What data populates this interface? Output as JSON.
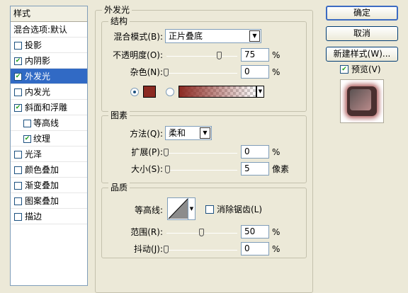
{
  "styles_panel": {
    "header": "样式",
    "blend_options": "混合选项:默认",
    "items": [
      {
        "label": "投影",
        "checked": false,
        "selected": false,
        "indent": 0
      },
      {
        "label": "内阴影",
        "checked": true,
        "selected": false,
        "indent": 0
      },
      {
        "label": "外发光",
        "checked": true,
        "selected": true,
        "indent": 0
      },
      {
        "label": "内发光",
        "checked": false,
        "selected": false,
        "indent": 0
      },
      {
        "label": "斜面和浮雕",
        "checked": true,
        "selected": false,
        "indent": 0
      },
      {
        "label": "等高线",
        "checked": false,
        "selected": false,
        "indent": 1
      },
      {
        "label": "纹理",
        "checked": true,
        "selected": false,
        "indent": 1
      },
      {
        "label": "光泽",
        "checked": false,
        "selected": false,
        "indent": 0
      },
      {
        "label": "颜色叠加",
        "checked": false,
        "selected": false,
        "indent": 0
      },
      {
        "label": "渐变叠加",
        "checked": false,
        "selected": false,
        "indent": 0
      },
      {
        "label": "图案叠加",
        "checked": false,
        "selected": false,
        "indent": 0
      },
      {
        "label": "描边",
        "checked": false,
        "selected": false,
        "indent": 0
      }
    ]
  },
  "outer_glow": {
    "title": "外发光",
    "structure": {
      "title": "结构",
      "blend_mode_label": "混合模式(B):",
      "blend_mode_value": "正片叠底",
      "opacity_label": "不透明度(O):",
      "opacity_value": "75",
      "opacity_level": 0.75,
      "noise_label": "杂色(N):",
      "noise_value": "0",
      "noise_level": 0,
      "percent": "%",
      "glow_color": "#8b2a22"
    },
    "elements": {
      "title": "图素",
      "method_label": "方法(Q):",
      "method_value": "柔和",
      "spread_label": "扩展(P):",
      "spread_value": "0",
      "spread_level": 0,
      "size_label": "大小(S):",
      "size_value": "5",
      "size_level": 0.02,
      "percent": "%",
      "px_unit": "像素"
    },
    "quality": {
      "title": "品质",
      "contour_label": "等高线:",
      "anti_alias_label": "消除锯齿(L)",
      "anti_alias_checked": false,
      "range_label": "范围(R):",
      "range_value": "50",
      "range_level": 0.5,
      "jitter_label": "抖动(J):",
      "jitter_value": "0",
      "jitter_level": 0,
      "percent": "%"
    }
  },
  "buttons": {
    "ok": "确定",
    "cancel": "取消",
    "new_style": "新建样式(W)...",
    "preview_label": "预览(V)",
    "preview_checked": true
  },
  "icons": {
    "dropdown": "triangle-down",
    "check": "check-mark"
  }
}
